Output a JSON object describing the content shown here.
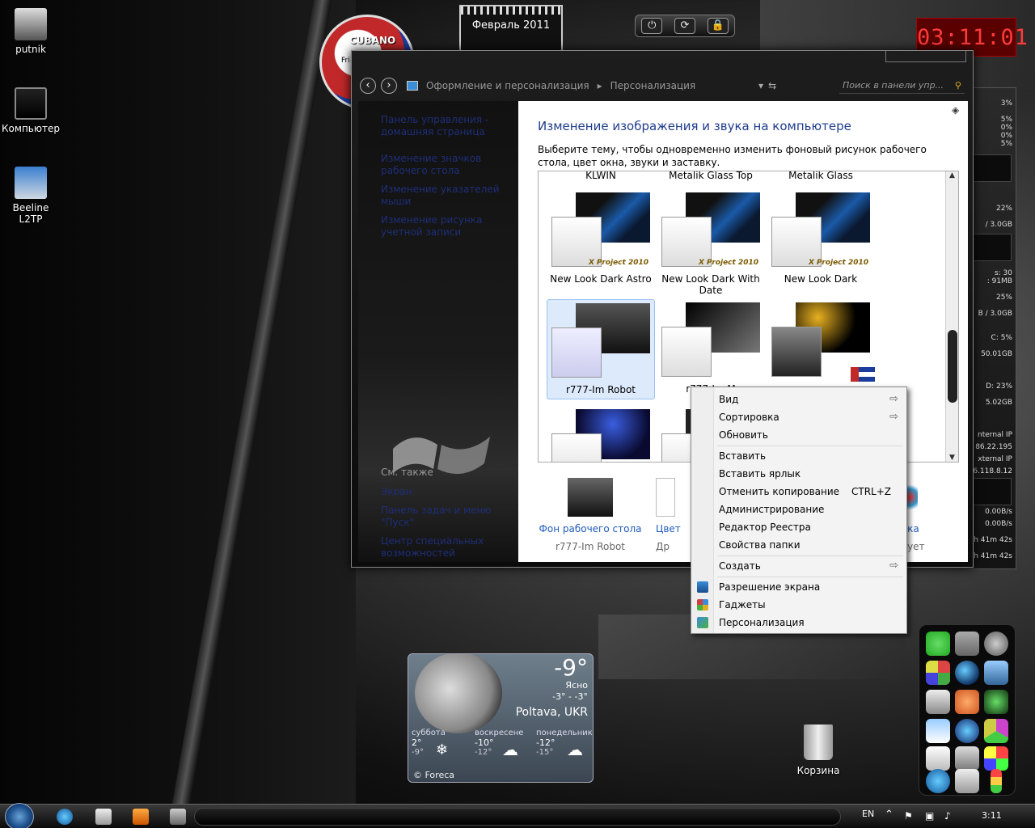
{
  "desktop_icons": [
    {
      "label": "putnik"
    },
    {
      "label": "Компьютер"
    },
    {
      "label": "Beeline L2TP"
    }
  ],
  "cubano": {
    "title": "CUBANO",
    "day": "Fri"
  },
  "calendar": {
    "title": "Февраль 2011"
  },
  "power_buttons": {
    "power": "⏻",
    "restart": "⟳",
    "lock": "🔒"
  },
  "clock": {
    "time": "03:11:01"
  },
  "meters": {
    "values": [
      "3%",
      "5%",
      "0%",
      "0%",
      "5%",
      "22%",
      "/ 3.0GB",
      "s: 30",
      ": 91MB",
      "25%",
      "B / 3.0GB",
      "C:  5%",
      "50.01GB",
      "D:  23%",
      "5.02GB",
      "nternal IP",
      "86.22.195",
      "xternal IP",
      "6.118.8.12",
      "0.00B/s",
      "0.00B/s",
      "h 41m 42s",
      "h 41m 42s"
    ]
  },
  "window": {
    "breadcrumb": [
      "Оформление и персонализация",
      "Персонализация"
    ],
    "search_placeholder": "Поиск в панели упр...",
    "side_links": [
      "Панель управления - домашняя страница",
      "Изменение значков рабочего стола",
      "Изменение указателей мыши",
      "Изменение рисунка учетной записи"
    ],
    "see_also_title": "См. также",
    "see_also_links": [
      "Экран",
      "Панель задач и меню \"Пуск\"",
      "Центр специальных возможностей"
    ],
    "heading": "Изменение изображения и звука на компьютере",
    "description": "Выберите тему, чтобы одновременно изменить фоновый рисунок рабочего стола, цвет окна, звуки и заставку.",
    "theme_headers": [
      "KLWIN",
      "Metalik Glass Top",
      "Metalik Glass"
    ],
    "themes_row1": [
      "New Look Dark Astro",
      "New Look Dark With Date",
      "New Look Dark"
    ],
    "theme_badge": "X Project 2010",
    "themes_row2": [
      "r777-Im Robot",
      "r777-Im M",
      ""
    ],
    "bottom": {
      "bg_label": "Фон рабочего стола",
      "bg_sub": "r777-Im Robot",
      "color_label": "Цвет",
      "color_sub": "Др",
      "screensaver_label": "вка",
      "screensaver_sub": "вует"
    }
  },
  "context_menu": {
    "items": [
      {
        "label": "Вид",
        "submenu": true
      },
      {
        "label": "Сортировка",
        "submenu": true
      },
      {
        "label": "Обновить"
      },
      {
        "label": "Вставить"
      },
      {
        "label": "Вставить ярлык"
      },
      {
        "label": "Отменить копирование",
        "shortcut": "CTRL+Z"
      },
      {
        "label": "Администрирование"
      },
      {
        "label": "Редактор Реестра"
      },
      {
        "label": "Свойства папки"
      },
      {
        "label": "Создать",
        "submenu": true
      },
      {
        "label": "Разрешение экрана"
      },
      {
        "label": "Гаджеты"
      },
      {
        "label": "Персонализация"
      }
    ],
    "arrow": "⇨"
  },
  "weather": {
    "temp": "-9°",
    "condition": "Ясно",
    "range": "-3° - -3°",
    "city": "Poltava, UKR",
    "forecast": [
      {
        "day": "суббота",
        "hi": "2°",
        "lo": "-9°"
      },
      {
        "day": "воскресене",
        "hi": "-10°",
        "lo": "-12°"
      },
      {
        "day": "понедельник",
        "hi": "-12°",
        "lo": "-15°"
      }
    ],
    "provider": "© Foreca"
  },
  "recycle_bin": {
    "label": "Корзина"
  },
  "taskbar": {
    "lang": "EN",
    "time": "3:11"
  },
  "colors": {
    "accent_link": "#1e5abc",
    "clock_red": "#ff3a3a",
    "panel_link_dark": "#1e2e78"
  }
}
